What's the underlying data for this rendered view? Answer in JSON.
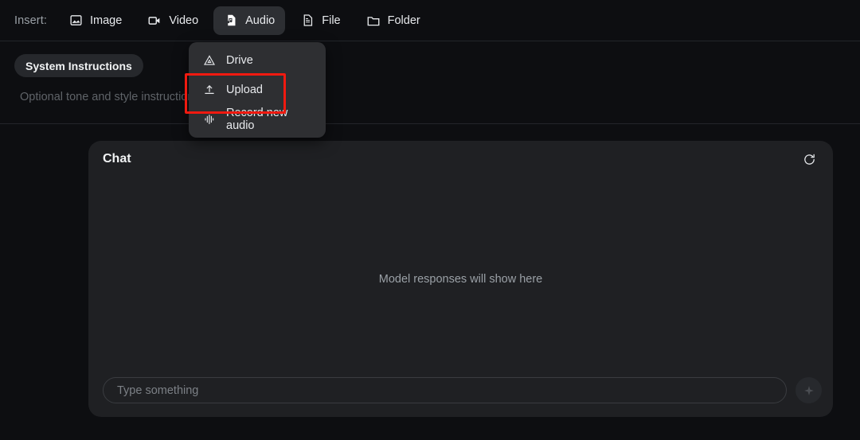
{
  "toolbar": {
    "label": "Insert:",
    "items": [
      {
        "label": "Image",
        "icon": "image-icon",
        "active": false
      },
      {
        "label": "Video",
        "icon": "video-icon",
        "active": false
      },
      {
        "label": "Audio",
        "icon": "audio-icon",
        "active": true
      },
      {
        "label": "File",
        "icon": "file-icon",
        "active": false
      },
      {
        "label": "Folder",
        "icon": "folder-icon",
        "active": false
      }
    ]
  },
  "system_instructions": {
    "chip_label": "System Instructions",
    "placeholder": "Optional tone and style instructions for the model"
  },
  "audio_menu": {
    "items": [
      {
        "label": "Drive",
        "icon": "drive-icon",
        "highlighted": false
      },
      {
        "label": "Upload",
        "icon": "upload-icon",
        "highlighted": true
      },
      {
        "label": "Record new audio",
        "icon": "waveform-icon",
        "highlighted": false
      }
    ],
    "highlight_color": "#f01a10"
  },
  "chat": {
    "title": "Chat",
    "refresh_icon": "refresh-icon",
    "empty_text": "Model responses will show here",
    "input_placeholder": "Type something",
    "input_value": "",
    "send_icon": "sparkle-send-icon"
  },
  "colors": {
    "page_background": "#0d0e11",
    "panel_background": "#1f2023",
    "menu_background": "#2e2f32",
    "accent_highlight": "#f01a10",
    "text_primary": "#e8eaed",
    "text_muted": "#9aa0a6"
  }
}
